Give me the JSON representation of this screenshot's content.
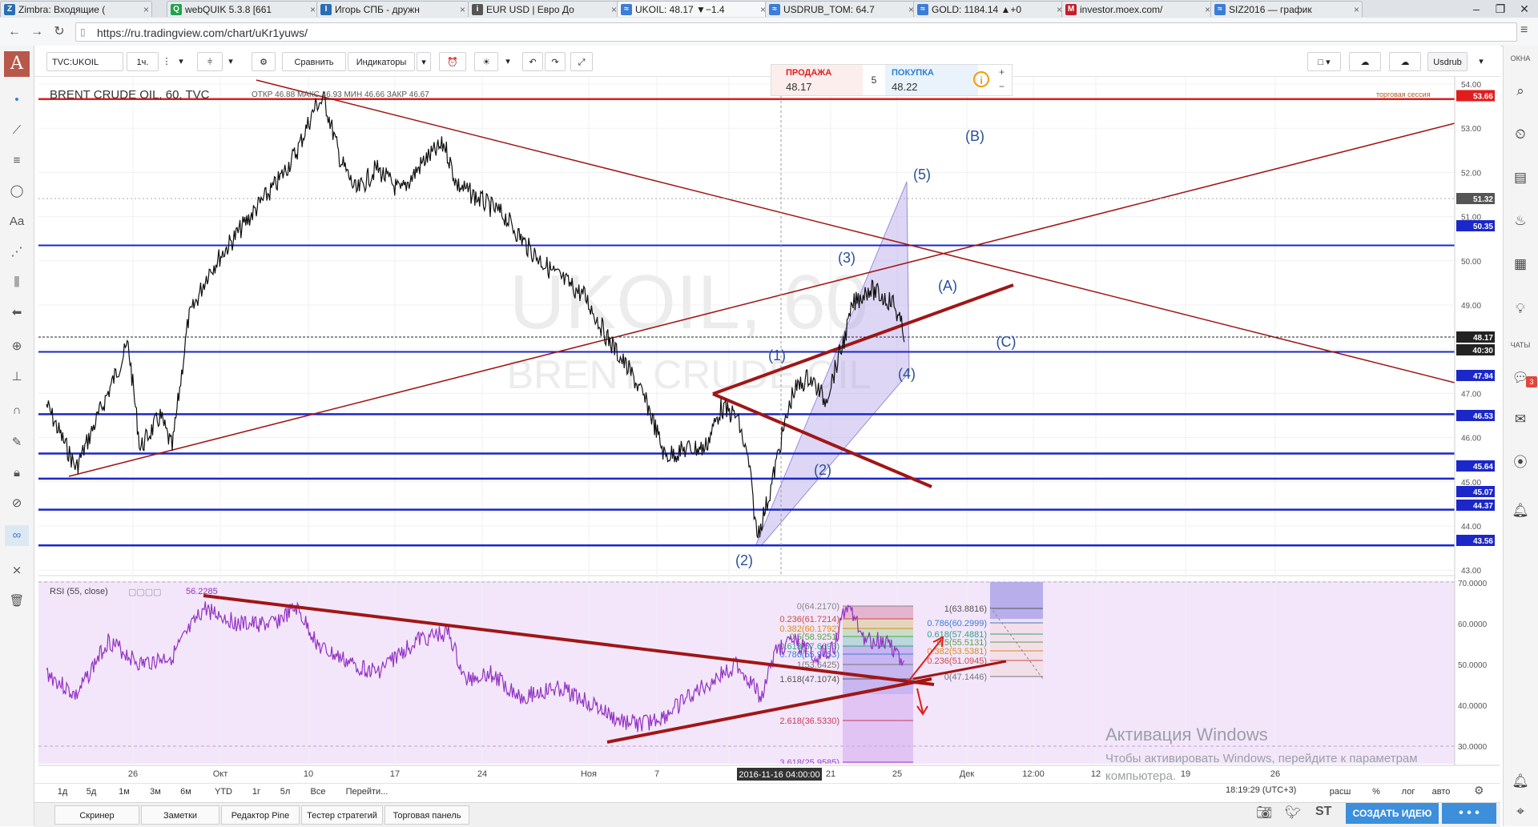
{
  "browser": {
    "tabs": [
      {
        "title": "Zimbra: Входящие (",
        "fav": "Z",
        "color": "#2a6fb5",
        "active": false
      },
      {
        "title": "webQUIK 5.3.8 [661",
        "fav": "Q",
        "color": "#1fa34a",
        "active": false
      },
      {
        "title": "Игорь СПБ - дружн",
        "fav": "I",
        "color": "#2a6fb5",
        "active": false
      },
      {
        "title": "EUR USD | Евро До",
        "fav": "i",
        "color": "#555555",
        "active": false
      },
      {
        "title": "UKOIL: 48.17 ▼−1.4",
        "fav": "≈",
        "color": "#3b7dd8",
        "active": true
      },
      {
        "title": "USDRUB_TOM: 64.7",
        "fav": "≈",
        "color": "#3b7dd8",
        "active": false
      },
      {
        "title": "GOLD: 1184.14 ▲+0",
        "fav": "≈",
        "color": "#3b7dd8",
        "active": false
      },
      {
        "title": "investor.moex.com/",
        "fav": "M",
        "color": "#c41e2a",
        "active": false
      },
      {
        "title": "SIZ2016 — график",
        "fav": "≈",
        "color": "#3b7dd8",
        "active": false
      }
    ],
    "url": "https://ru.tradingview.com/chart/uKr1yuws/"
  },
  "toolbar": {
    "symbol": "TVC:UKOIL",
    "interval": "1ч.",
    "compare": "Сравнить",
    "indicators": "Индикаторы",
    "currency": "Usdrub"
  },
  "trade": {
    "sell_label": "ПРОДАЖА",
    "sell_price": "48.17",
    "spread": "5",
    "buy_label": "ПОКУПКА",
    "buy_price": "48.22"
  },
  "chart": {
    "title": "BRENT CRUDE OIL, 60, TVC",
    "ohlc": "ОТКР 46.88  МАКС 46.93  МИН 46.66  ЗАКР 46.67",
    "watermark_symbol": "UKOIL, 60",
    "watermark_name": "BRENT CRUDE OIL",
    "session_label": "торговая сессия",
    "price_ticks": [
      "54.00",
      "53.00",
      "52.00",
      "51.00",
      "50.00",
      "49.00",
      "48.00",
      "47.00",
      "46.00",
      "45.00",
      "44.00",
      "43.00"
    ],
    "price_badges": [
      {
        "text": "53.66",
        "color": "#e21c1c"
      },
      {
        "text": "51.32",
        "color": "#555555"
      },
      {
        "text": "50.35",
        "color": "#1b27c9"
      },
      {
        "text": "48.17",
        "color": "#222222"
      },
      {
        "text": "40:30",
        "color": "#222222"
      },
      {
        "text": "47.94",
        "color": "#1b27c9"
      },
      {
        "text": "46.53",
        "color": "#1b27c9"
      },
      {
        "text": "45.64",
        "color": "#1b27c9"
      },
      {
        "text": "45.07",
        "color": "#1b27c9"
      },
      {
        "text": "44.37",
        "color": "#1b27c9"
      },
      {
        "text": "43.56",
        "color": "#1b27c9"
      }
    ],
    "wave_labels": [
      "(B)",
      "(5)",
      "(3)",
      "(A)",
      "(1)",
      "(C)",
      "(4)",
      "(2)",
      "(2)"
    ],
    "time_ticks": [
      "26",
      "Окт",
      "10",
      "17",
      "24",
      "Ноя",
      "7",
      "21",
      "25",
      "Дек",
      "12:00",
      "12",
      "19",
      "26"
    ],
    "crosshair_date": "2016-11-16 04:00:00"
  },
  "rsi": {
    "title": "RSI (55, close)",
    "value": "56.2285",
    "ticks": [
      "70.0000",
      "60.0000",
      "50.0000",
      "40.0000",
      "30.0000"
    ],
    "fib_left": [
      "0(64.2170)",
      "0.236(61.7214)",
      "0.382(60.1792)",
      "0.5(58.9251)",
      "0.618(57.6693)",
      "0.786(55.9053)",
      "1(53.6425)",
      "1.618(47.1074)",
      "2.618(36.5330)",
      "3.618(25.9585)"
    ],
    "fib_right": [
      "1(63.8816)",
      "0.786(60.2999)",
      "0.618(57.4881)",
      "0.5(55.5131)",
      "0.382(53.5381)",
      "0.236(51.0945)",
      "0(47.1446)"
    ]
  },
  "timeframes": [
    "1д",
    "5д",
    "1м",
    "3м",
    "6м",
    "YTD",
    "1г",
    "5л",
    "Все",
    "Перейти..."
  ],
  "status": {
    "clock": "18:19:29 (UTC+3)",
    "scale_options": [
      "расш",
      "%",
      "лог",
      "авто"
    ]
  },
  "bottom_tabs": [
    "Скринер",
    "Заметки",
    "Редактор Pine",
    "Тестер стратегий",
    "Торговая панель"
  ],
  "create_idea": "СОЗДАТЬ ИДЕЮ",
  "sidebar_labels": [
    "ОКНА",
    "ЧАТЫ"
  ],
  "chat_badge": "3",
  "windows_activation": {
    "title": "Активация Windows",
    "message": "Чтобы активировать Windows, перейдите к параметрам компьютера."
  }
}
